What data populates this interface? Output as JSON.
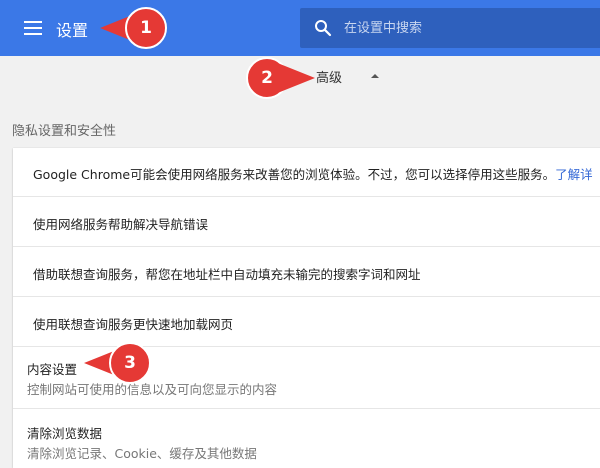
{
  "header": {
    "title": "设置",
    "search_placeholder": "在设置中搜索"
  },
  "advanced_toggle": {
    "label": "高级"
  },
  "privacy": {
    "section_title": "隐私设置和安全性",
    "google_services": {
      "text": "Google Chrome可能会使用网络服务来改善您的浏览体验。不过，您可以选择停用这些服务。",
      "link": "了解详"
    },
    "nav_errors": "使用网络服务帮助解决导航错误",
    "autocomplete": "借助联想查询服务，帮您在地址栏中自动填充未输完的搜索字词和网址",
    "prefetch": "使用联想查询服务更快速地加载网页",
    "content_settings": {
      "title": "内容设置",
      "subtitle": "控制网站可使用的信息以及可向您显示的内容"
    },
    "clear_data": {
      "title": "清除浏览数据",
      "subtitle": "清除浏览记录、Cookie、缓存及其他数据"
    }
  },
  "callouts": {
    "one": "1",
    "two": "2",
    "three": "3"
  },
  "colors": {
    "header_bg": "#3b78e7",
    "search_bg": "#2e60bd",
    "callout_red": "#e53935",
    "link": "#3367d6"
  }
}
